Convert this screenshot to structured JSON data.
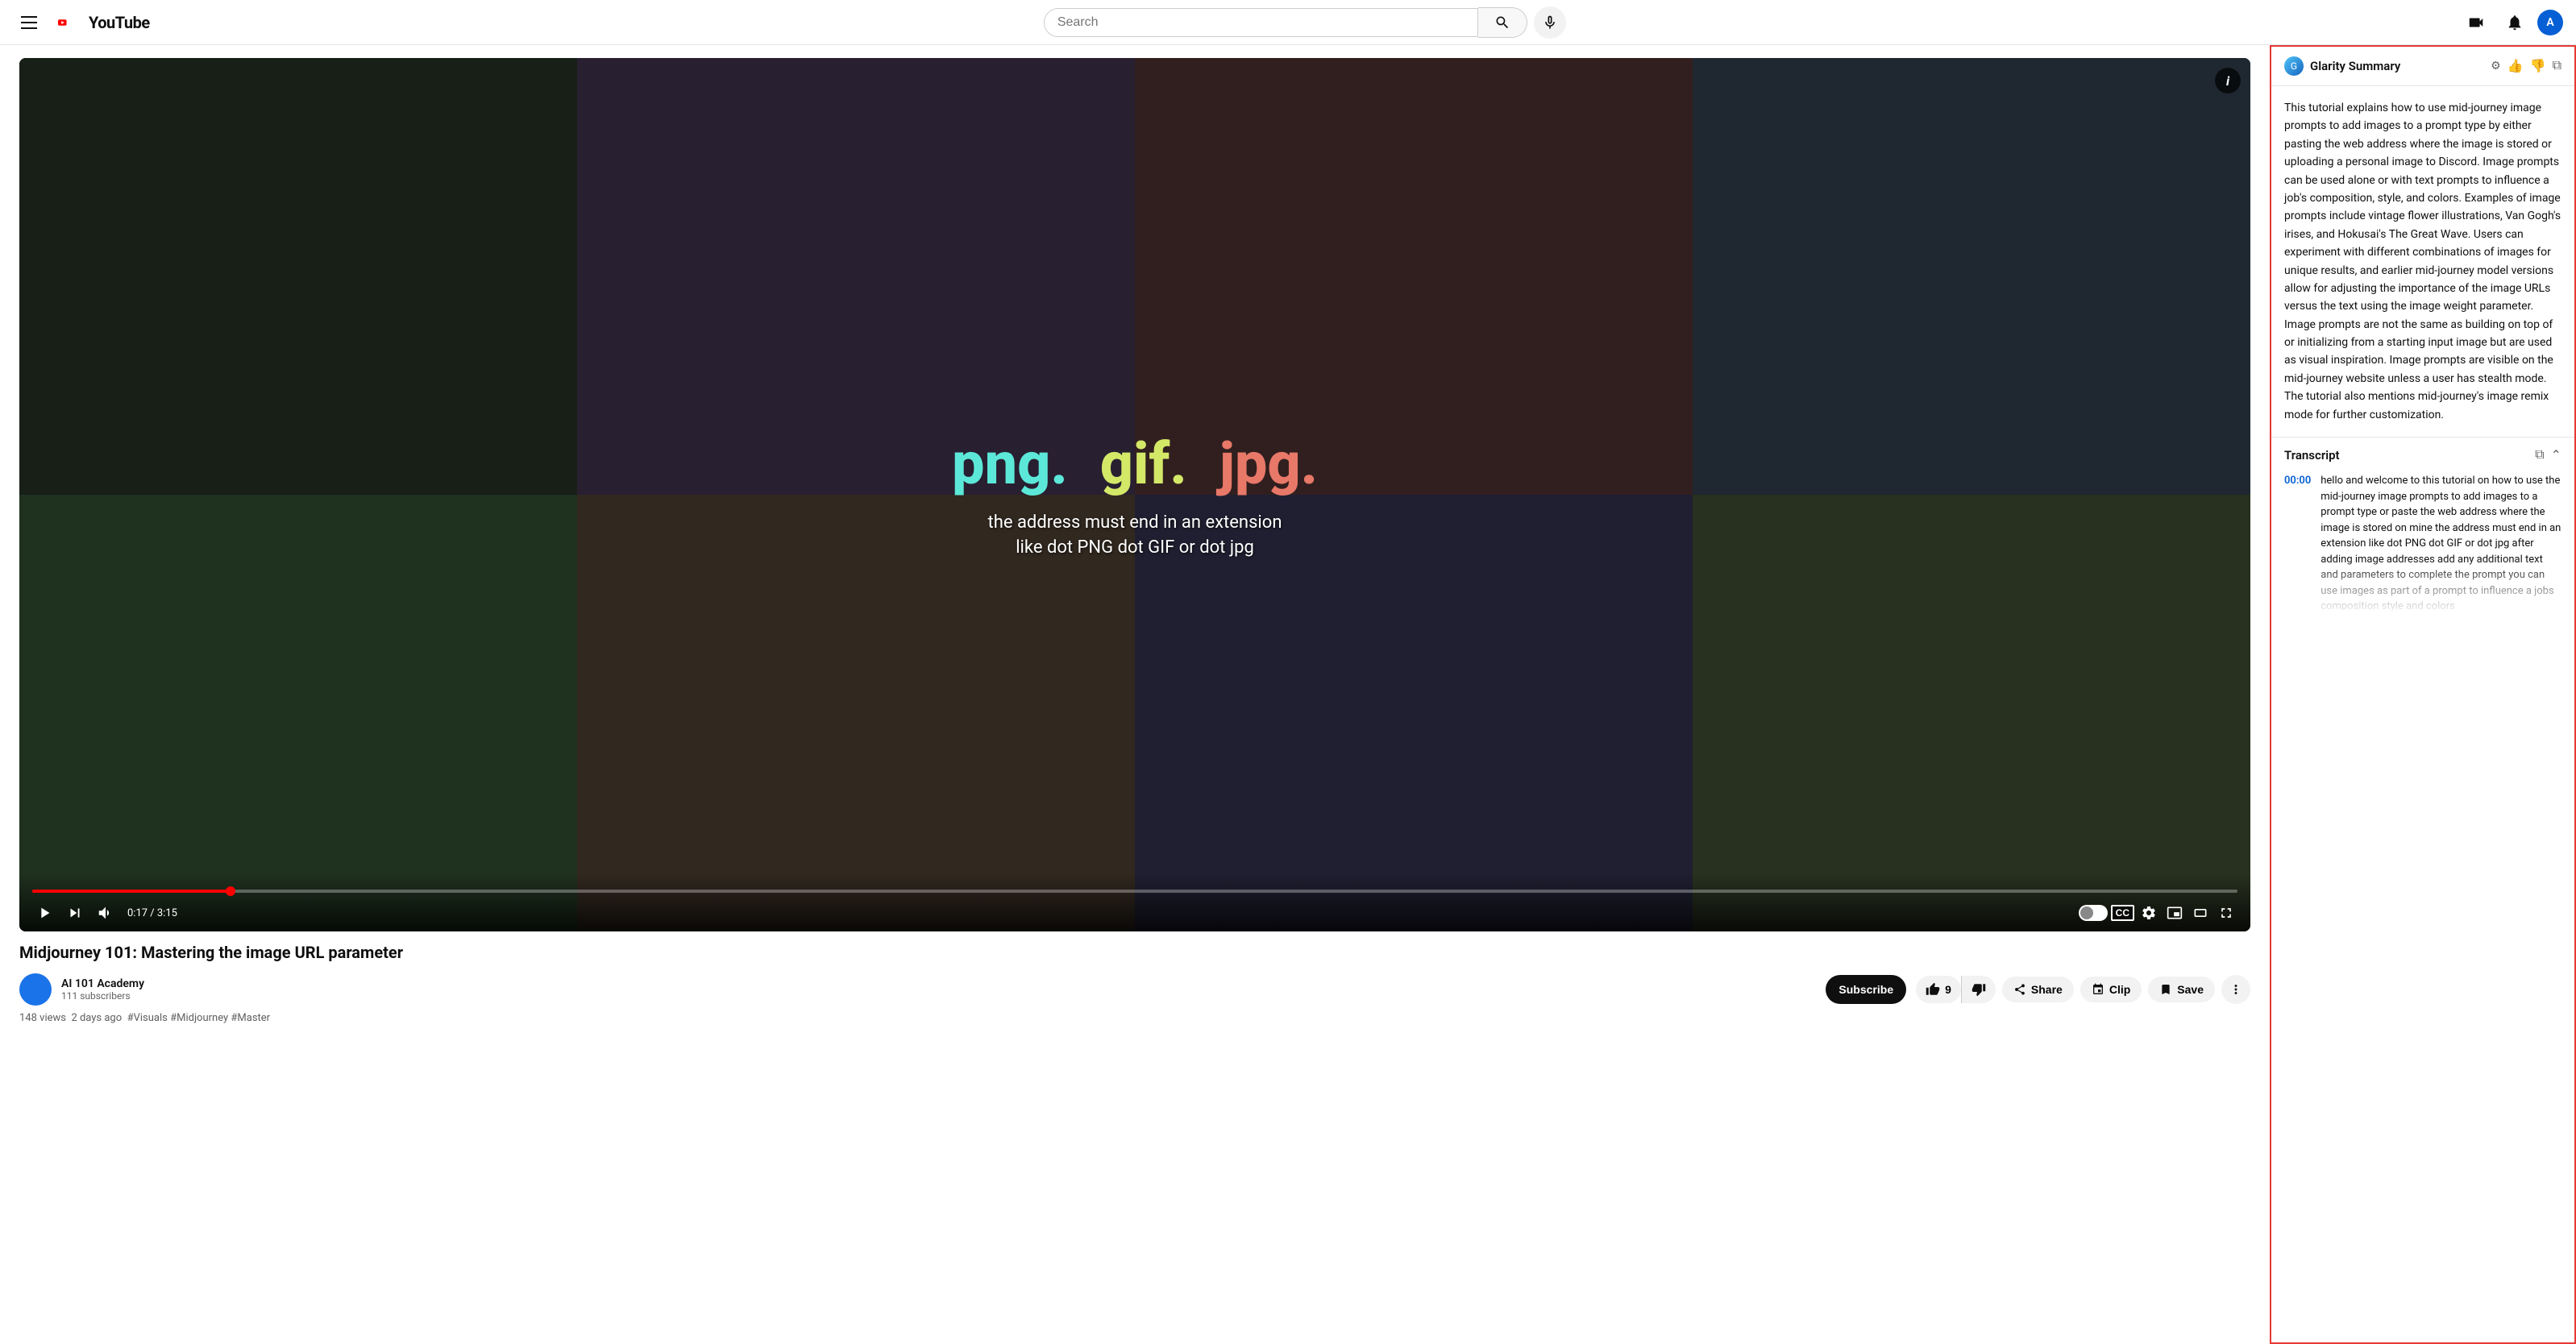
{
  "header": {
    "search_placeholder": "Search",
    "youtube_text": "YouTube",
    "create_tooltip": "Create",
    "notifications_tooltip": "Notifications",
    "avatar_initial": "A"
  },
  "video": {
    "file_types": {
      "png": "png.",
      "gif": "gif.",
      "jpg": "jpg."
    },
    "subtitle": "the address must end in an extension\nlike dot PNG dot GIF or dot jpg",
    "time_current": "0:17",
    "time_total": "3:15",
    "progress_percent": 9,
    "title": "Midjourney 101: Mastering the image URL parameter",
    "views": "148 views",
    "upload_date": "2 days ago",
    "hashtags": "#Visuals #Midjourney #Master",
    "like_count": "9"
  },
  "channel": {
    "name": "AI 101 Academy",
    "subscribers": "111 subscribers",
    "subscribe_label": "Subscribe"
  },
  "actions": {
    "like_label": "9",
    "share_label": "Share",
    "clip_label": "Clip",
    "save_label": "Save"
  },
  "glarity": {
    "title": "Glarity Summary",
    "summary": "This tutorial explains how to use mid-journey image prompts to add images to a prompt type by either pasting the web address where the image is stored or uploading a personal image to Discord. Image prompts can be used alone or with text prompts to influence a job's composition, style, and colors. Examples of image prompts include vintage flower illustrations, Van Gogh's irises, and Hokusai's The Great Wave. Users can experiment with different combinations of images for unique results, and earlier mid-journey model versions allow for adjusting the importance of the image URLs versus the text using the image weight parameter. Image prompts are not the same as building on top of or initializing from a starting input image but are used as visual inspiration. Image prompts are visible on the mid-journey website unless a user has stealth mode. The tutorial also mentions mid-journey's image remix mode for further customization.",
    "transcript_label": "Transcript",
    "transcript_entries": [
      {
        "time": "00:00",
        "text": "hello and welcome to this tutorial on how to use the mid-journey image prompts to add images to a prompt type or paste the web address where the image is stored on mine the address must end in an extension like dot PNG dot GIF or dot jpg after adding image addresses add any additional text and parameters to complete the prompt you can use images as part of a prompt to influence a jobs composition style and colors"
      }
    ]
  }
}
